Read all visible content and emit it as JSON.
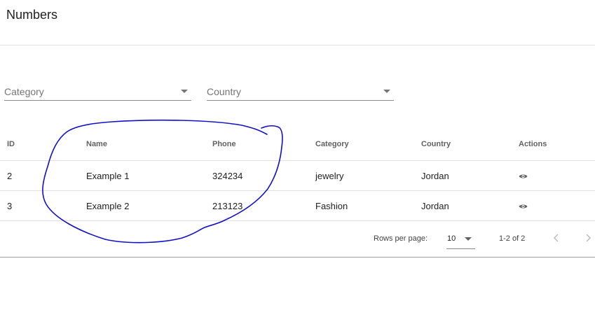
{
  "page": {
    "title": "Numbers"
  },
  "filters": {
    "category_placeholder": "Category",
    "country_placeholder": "Country"
  },
  "table": {
    "columns": [
      "ID",
      "Name",
      "Phone",
      "Category",
      "Country",
      "Actions"
    ],
    "rows": [
      {
        "id": "2",
        "name": "Example 1",
        "phone": "324234",
        "category": "jewelry",
        "country": "Jordan",
        "action_icon": "eye-icon"
      },
      {
        "id": "3",
        "name": "Example 2",
        "phone": "213123",
        "category": "Fashion",
        "country": "Jordan",
        "action_icon": "eye-icon"
      }
    ]
  },
  "pagination": {
    "rows_per_page_label": "Rows per page:",
    "rows_per_page_value": "10",
    "range_label": "1-2 of 2",
    "prev_icon": "chevron-left-icon",
    "next_icon": "chevron-right-icon"
  },
  "annotation": {
    "color": "#1010c8"
  }
}
